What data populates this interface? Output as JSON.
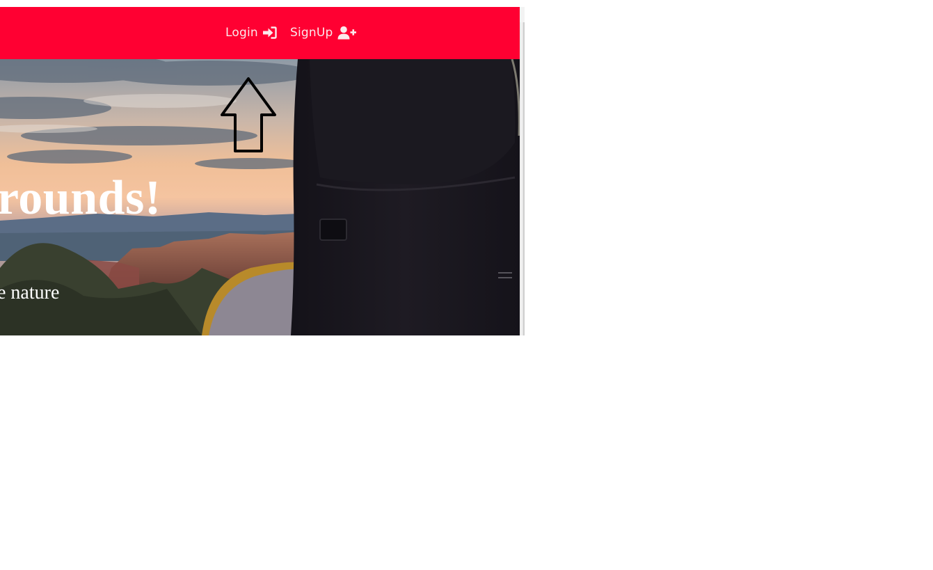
{
  "navbar": {
    "items": [
      {
        "label": "Login",
        "icon": "sign-in-icon"
      },
      {
        "label": "SignUp",
        "icon": "user-plus-icon"
      }
    ],
    "colors": {
      "background": "#ff0032",
      "text": "#fbe9ec"
    }
  },
  "hero": {
    "title": "rounds!",
    "subtitle": "e nature",
    "image": "canyon sunset view from camper van door",
    "colors": {
      "text": "#ffffff"
    }
  },
  "annotation": {
    "icon": "up-arrow-icon",
    "color": "#000000"
  }
}
